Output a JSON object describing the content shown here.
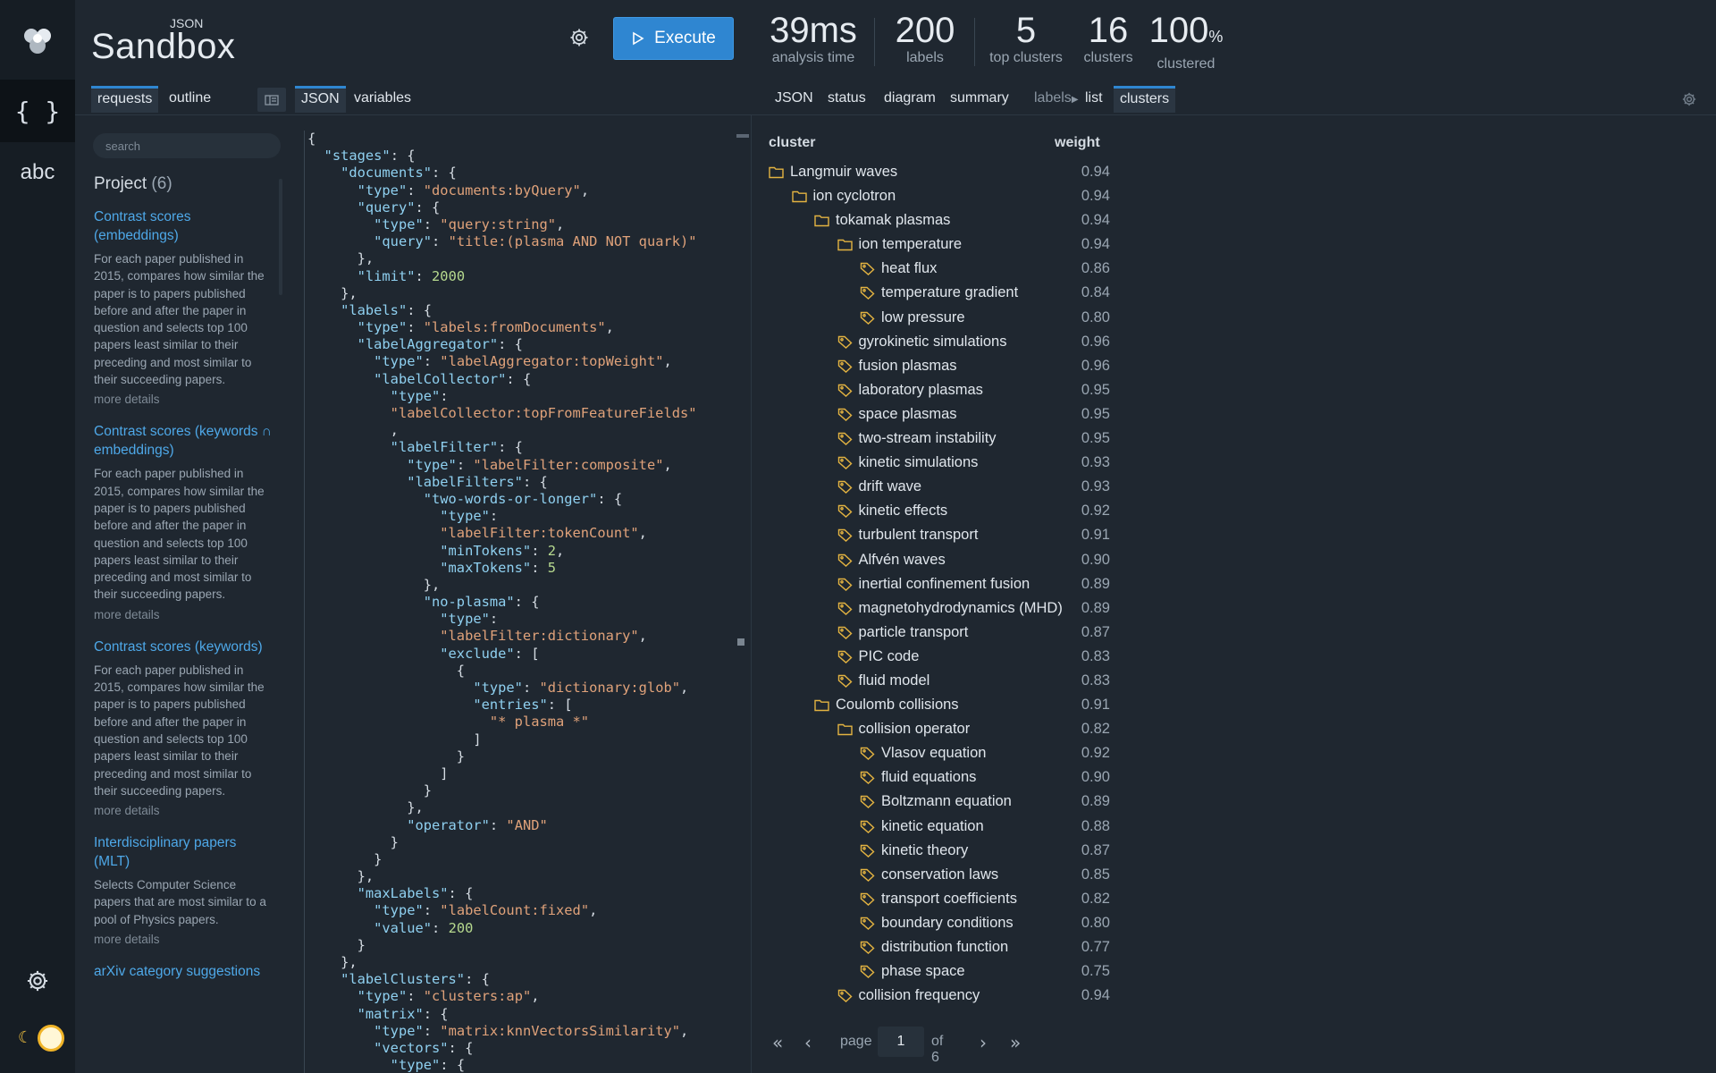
{
  "brand": {
    "sub": "JSON",
    "name": "Sandbox"
  },
  "execute_label": "Execute",
  "stats": [
    {
      "value": "39ms",
      "label": "analysis time"
    },
    {
      "value": "200",
      "label": "labels"
    },
    {
      "value": "5",
      "label": "top clusters"
    },
    {
      "value": "16",
      "label": "clusters"
    },
    {
      "value": "100",
      "unit": "%",
      "label": "clustered"
    }
  ],
  "left_tabs": [
    "requests",
    "outline"
  ],
  "editor_tabs": [
    "JSON",
    "variables"
  ],
  "result_tabs": [
    "JSON",
    "status",
    "diagram",
    "summary"
  ],
  "result_labels_prefix": "labels",
  "result_sub_tabs": [
    "list",
    "clusters"
  ],
  "search": {
    "placeholder": "search"
  },
  "project": {
    "title": "Project",
    "count": "(6)",
    "items": [
      {
        "title": "Contrast scores (embeddings)",
        "desc": "For each paper published in 2015, compares how similar the paper is to papers published before and after the paper in question and selects top 100 papers least similar to their preceding and most similar to their succeeding papers.",
        "more": "more details"
      },
      {
        "title": "Contrast scores (keywords ∩ embeddings)",
        "desc": "For each paper published in 2015, compares how similar the paper is to papers published before and after the paper in question and selects top 100 papers least similar to their preceding and most similar to their succeeding papers.",
        "more": "more details"
      },
      {
        "title": "Contrast scores (keywords)",
        "desc": "For each paper published in 2015, compares how similar the paper is to papers published before and after the paper in question and selects top 100 papers least similar to their preceding and most similar to their succeeding papers.",
        "more": "more details"
      },
      {
        "title": "Interdisciplinary papers (MLT)",
        "desc": "Selects Computer Science papers that are most similar to a pool of Physics papers.",
        "more": "more details"
      },
      {
        "title": "arXiv category suggestions",
        "desc": "",
        "more": ""
      }
    ]
  },
  "editor_lines": [
    [
      [
        "p",
        "{"
      ]
    ],
    [
      [
        "p",
        "  "
      ],
      [
        "k",
        "\"stages\""
      ],
      [
        "p",
        ": {"
      ]
    ],
    [
      [
        "p",
        "    "
      ],
      [
        "k",
        "\"documents\""
      ],
      [
        "p",
        ": {"
      ]
    ],
    [
      [
        "p",
        "      "
      ],
      [
        "k",
        "\"type\""
      ],
      [
        "p",
        ": "
      ],
      [
        "s",
        "\"documents:byQuery\""
      ],
      [
        "p",
        ","
      ]
    ],
    [
      [
        "p",
        "      "
      ],
      [
        "k",
        "\"query\""
      ],
      [
        "p",
        ": {"
      ]
    ],
    [
      [
        "p",
        "        "
      ],
      [
        "k",
        "\"type\""
      ],
      [
        "p",
        ": "
      ],
      [
        "s",
        "\"query:string\""
      ],
      [
        "p",
        ","
      ]
    ],
    [
      [
        "p",
        "        "
      ],
      [
        "k",
        "\"query\""
      ],
      [
        "p",
        ": "
      ],
      [
        "s",
        "\"title:(plasma AND NOT quark)\""
      ]
    ],
    [
      [
        "p",
        "      },"
      ]
    ],
    [
      [
        "p",
        "      "
      ],
      [
        "k",
        "\"limit\""
      ],
      [
        "p",
        ": "
      ],
      [
        "n",
        "2000"
      ]
    ],
    [
      [
        "p",
        "    },"
      ]
    ],
    [
      [
        "p",
        "    "
      ],
      [
        "k",
        "\"labels\""
      ],
      [
        "p",
        ": {"
      ]
    ],
    [
      [
        "p",
        "      "
      ],
      [
        "k",
        "\"type\""
      ],
      [
        "p",
        ": "
      ],
      [
        "s",
        "\"labels:fromDocuments\""
      ],
      [
        "p",
        ","
      ]
    ],
    [
      [
        "p",
        "      "
      ],
      [
        "k",
        "\"labelAggregator\""
      ],
      [
        "p",
        ": {"
      ]
    ],
    [
      [
        "p",
        "        "
      ],
      [
        "k",
        "\"type\""
      ],
      [
        "p",
        ": "
      ],
      [
        "s",
        "\"labelAggregator:topWeight\""
      ],
      [
        "p",
        ","
      ]
    ],
    [
      [
        "p",
        "        "
      ],
      [
        "k",
        "\"labelCollector\""
      ],
      [
        "p",
        ": {"
      ]
    ],
    [
      [
        "p",
        "          "
      ],
      [
        "k",
        "\"type\""
      ],
      [
        "p",
        ":"
      ]
    ],
    [
      [
        "p",
        "          "
      ],
      [
        "s",
        "\"labelCollector:topFromFeatureFields\""
      ]
    ],
    [
      [
        "p",
        "          ,"
      ]
    ],
    [
      [
        "p",
        "          "
      ],
      [
        "k",
        "\"labelFilter\""
      ],
      [
        "p",
        ": {"
      ]
    ],
    [
      [
        "p",
        "            "
      ],
      [
        "k",
        "\"type\""
      ],
      [
        "p",
        ": "
      ],
      [
        "s",
        "\"labelFilter:composite\""
      ],
      [
        "p",
        ","
      ]
    ],
    [
      [
        "p",
        "            "
      ],
      [
        "k",
        "\"labelFilters\""
      ],
      [
        "p",
        ": {"
      ]
    ],
    [
      [
        "p",
        "              "
      ],
      [
        "k",
        "\"two-words-or-longer\""
      ],
      [
        "p",
        ": {"
      ]
    ],
    [
      [
        "p",
        "                "
      ],
      [
        "k",
        "\"type\""
      ],
      [
        "p",
        ":"
      ]
    ],
    [
      [
        "p",
        "                "
      ],
      [
        "s",
        "\"labelFilter:tokenCount\""
      ],
      [
        "p",
        ","
      ]
    ],
    [
      [
        "p",
        "                "
      ],
      [
        "k",
        "\"minTokens\""
      ],
      [
        "p",
        ": "
      ],
      [
        "n",
        "2"
      ],
      [
        "p",
        ","
      ]
    ],
    [
      [
        "p",
        "                "
      ],
      [
        "k",
        "\"maxTokens\""
      ],
      [
        "p",
        ": "
      ],
      [
        "n",
        "5"
      ]
    ],
    [
      [
        "p",
        "              },"
      ]
    ],
    [
      [
        "p",
        "              "
      ],
      [
        "k",
        "\"no-plasma\""
      ],
      [
        "p",
        ": {"
      ]
    ],
    [
      [
        "p",
        "                "
      ],
      [
        "k",
        "\"type\""
      ],
      [
        "p",
        ":"
      ]
    ],
    [
      [
        "p",
        "                "
      ],
      [
        "s",
        "\"labelFilter:dictionary\""
      ],
      [
        "p",
        ","
      ]
    ],
    [
      [
        "p",
        "                "
      ],
      [
        "k",
        "\"exclude\""
      ],
      [
        "p",
        ": ["
      ]
    ],
    [
      [
        "p",
        "                  {"
      ]
    ],
    [
      [
        "p",
        "                    "
      ],
      [
        "k",
        "\"type\""
      ],
      [
        "p",
        ": "
      ],
      [
        "s",
        "\"dictionary:glob\""
      ],
      [
        "p",
        ","
      ]
    ],
    [
      [
        "p",
        "                    "
      ],
      [
        "k",
        "\"entries\""
      ],
      [
        "p",
        ": ["
      ]
    ],
    [
      [
        "p",
        "                      "
      ],
      [
        "s",
        "\"* plasma *\""
      ]
    ],
    [
      [
        "p",
        "                    ]"
      ]
    ],
    [
      [
        "p",
        "                  }"
      ]
    ],
    [
      [
        "p",
        "                ]"
      ]
    ],
    [
      [
        "p",
        "              }"
      ]
    ],
    [
      [
        "p",
        "            },"
      ]
    ],
    [
      [
        "p",
        "            "
      ],
      [
        "k",
        "\"operator\""
      ],
      [
        "p",
        ": "
      ],
      [
        "s",
        "\"AND\""
      ]
    ],
    [
      [
        "p",
        "          }"
      ]
    ],
    [
      [
        "p",
        "        }"
      ]
    ],
    [
      [
        "p",
        "      },"
      ]
    ],
    [
      [
        "p",
        "      "
      ],
      [
        "k",
        "\"maxLabels\""
      ],
      [
        "p",
        ": {"
      ]
    ],
    [
      [
        "p",
        "        "
      ],
      [
        "k",
        "\"type\""
      ],
      [
        "p",
        ": "
      ],
      [
        "s",
        "\"labelCount:fixed\""
      ],
      [
        "p",
        ","
      ]
    ],
    [
      [
        "p",
        "        "
      ],
      [
        "k",
        "\"value\""
      ],
      [
        "p",
        ": "
      ],
      [
        "n",
        "200"
      ]
    ],
    [
      [
        "p",
        "      }"
      ]
    ],
    [
      [
        "p",
        "    },"
      ]
    ],
    [
      [
        "p",
        "    "
      ],
      [
        "k",
        "\"labelClusters\""
      ],
      [
        "p",
        ": {"
      ]
    ],
    [
      [
        "p",
        "      "
      ],
      [
        "k",
        "\"type\""
      ],
      [
        "p",
        ": "
      ],
      [
        "s",
        "\"clusters:ap\""
      ],
      [
        "p",
        ","
      ]
    ],
    [
      [
        "p",
        "      "
      ],
      [
        "k",
        "\"matrix\""
      ],
      [
        "p",
        ": {"
      ]
    ],
    [
      [
        "p",
        "        "
      ],
      [
        "k",
        "\"type\""
      ],
      [
        "p",
        ": "
      ],
      [
        "s",
        "\"matrix:knnVectorsSimilarity\""
      ],
      [
        "p",
        ","
      ]
    ],
    [
      [
        "p",
        "        "
      ],
      [
        "k",
        "\"vectors\""
      ],
      [
        "p",
        ": {"
      ]
    ],
    [
      [
        "p",
        "          "
      ],
      [
        "k",
        "\"type\""
      ],
      [
        "p",
        ": {"
      ]
    ]
  ],
  "tree": {
    "col_cluster": "cluster",
    "col_weight": "weight",
    "rows": [
      {
        "label": "Langmuir waves",
        "weight": "0.94",
        "depth": 0,
        "icon": "folder-icon"
      },
      {
        "label": "ion cyclotron",
        "weight": "0.94",
        "depth": 1,
        "icon": "folder-icon"
      },
      {
        "label": "tokamak plasmas",
        "weight": "0.94",
        "depth": 2,
        "icon": "folder-icon"
      },
      {
        "label": "ion temperature",
        "weight": "0.94",
        "depth": 3,
        "icon": "folder-icon"
      },
      {
        "label": "heat flux",
        "weight": "0.86",
        "depth": 4,
        "icon": "tag-icon"
      },
      {
        "label": "temperature gradient",
        "weight": "0.84",
        "depth": 4,
        "icon": "tag-icon"
      },
      {
        "label": "low pressure",
        "weight": "0.80",
        "depth": 4,
        "icon": "tag-icon"
      },
      {
        "label": "gyrokinetic simulations",
        "weight": "0.96",
        "depth": 3,
        "icon": "tag-icon"
      },
      {
        "label": "fusion plasmas",
        "weight": "0.96",
        "depth": 3,
        "icon": "tag-icon"
      },
      {
        "label": "laboratory plasmas",
        "weight": "0.95",
        "depth": 3,
        "icon": "tag-icon"
      },
      {
        "label": "space plasmas",
        "weight": "0.95",
        "depth": 3,
        "icon": "tag-icon"
      },
      {
        "label": "two-stream instability",
        "weight": "0.95",
        "depth": 3,
        "icon": "tag-icon"
      },
      {
        "label": "kinetic simulations",
        "weight": "0.93",
        "depth": 3,
        "icon": "tag-icon"
      },
      {
        "label": "drift wave",
        "weight": "0.93",
        "depth": 3,
        "icon": "tag-icon"
      },
      {
        "label": "kinetic effects",
        "weight": "0.92",
        "depth": 3,
        "icon": "tag-icon"
      },
      {
        "label": "turbulent transport",
        "weight": "0.91",
        "depth": 3,
        "icon": "tag-icon"
      },
      {
        "label": "Alfvén waves",
        "weight": "0.90",
        "depth": 3,
        "icon": "tag-icon"
      },
      {
        "label": "inertial confinement fusion",
        "weight": "0.89",
        "depth": 3,
        "icon": "tag-icon"
      },
      {
        "label": "magnetohydrodynamics (MHD)",
        "weight": "0.89",
        "depth": 3,
        "icon": "tag-icon"
      },
      {
        "label": "particle transport",
        "weight": "0.87",
        "depth": 3,
        "icon": "tag-icon"
      },
      {
        "label": "PIC code",
        "weight": "0.83",
        "depth": 3,
        "icon": "tag-icon"
      },
      {
        "label": "fluid model",
        "weight": "0.83",
        "depth": 3,
        "icon": "tag-icon"
      },
      {
        "label": "Coulomb collisions",
        "weight": "0.91",
        "depth": 2,
        "icon": "folder-icon"
      },
      {
        "label": "collision operator",
        "weight": "0.82",
        "depth": 3,
        "icon": "folder-icon"
      },
      {
        "label": "Vlasov equation",
        "weight": "0.92",
        "depth": 4,
        "icon": "tag-icon"
      },
      {
        "label": "fluid equations",
        "weight": "0.90",
        "depth": 4,
        "icon": "tag-icon"
      },
      {
        "label": "Boltzmann equation",
        "weight": "0.89",
        "depth": 4,
        "icon": "tag-icon"
      },
      {
        "label": "kinetic equation",
        "weight": "0.88",
        "depth": 4,
        "icon": "tag-icon"
      },
      {
        "label": "kinetic theory",
        "weight": "0.87",
        "depth": 4,
        "icon": "tag-icon"
      },
      {
        "label": "conservation laws",
        "weight": "0.85",
        "depth": 4,
        "icon": "tag-icon"
      },
      {
        "label": "transport coefficients",
        "weight": "0.82",
        "depth": 4,
        "icon": "tag-icon"
      },
      {
        "label": "boundary conditions",
        "weight": "0.80",
        "depth": 4,
        "icon": "tag-icon"
      },
      {
        "label": "distribution function",
        "weight": "0.77",
        "depth": 4,
        "icon": "tag-icon"
      },
      {
        "label": "phase space",
        "weight": "0.75",
        "depth": 4,
        "icon": "tag-icon"
      },
      {
        "label": "collision frequency",
        "weight": "0.94",
        "depth": 3,
        "icon": "tag-icon"
      }
    ]
  },
  "pager": {
    "page_label": "page",
    "page": "1",
    "of_label": "of",
    "total": "6"
  },
  "colors": {
    "accent": "#2f86d1",
    "icon": "#e3b341",
    "link": "#4ea8e8"
  }
}
